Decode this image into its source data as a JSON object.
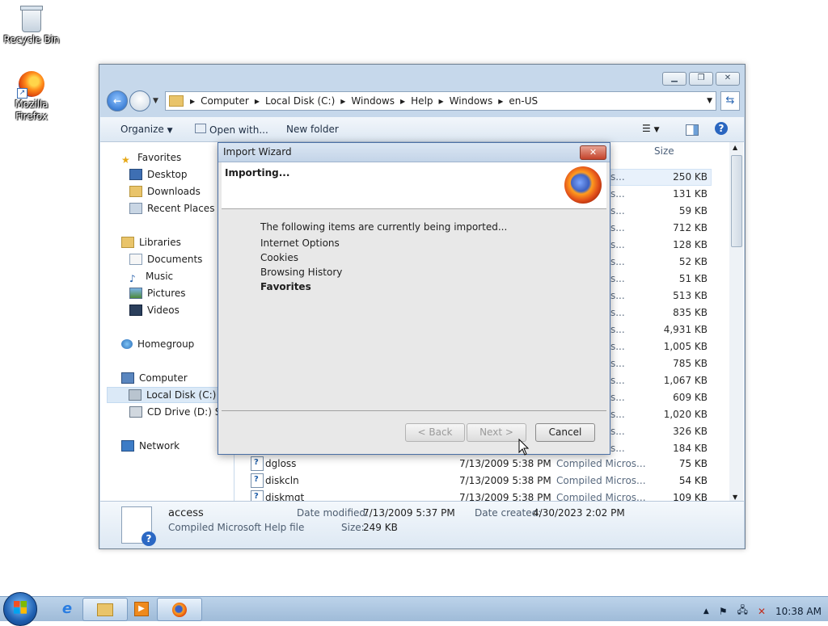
{
  "desktop": {
    "icons": [
      {
        "label": "Recycle Bin"
      },
      {
        "label_line1": "Mozilla",
        "label_line2": "Firefox"
      }
    ]
  },
  "explorer": {
    "caption_buttons": [
      "minimize",
      "restore",
      "close"
    ],
    "address": {
      "crumbs": [
        "Computer",
        "Local Disk (C:)",
        "Windows",
        "Help",
        "Windows",
        "en-US"
      ]
    },
    "toolbar": {
      "organize": "Organize",
      "open_with": "Open with...",
      "new_folder": "New folder"
    },
    "sidebar": {
      "favorites": "Favorites",
      "desktop": "Desktop",
      "downloads": "Downloads",
      "recent_places": "Recent Places",
      "libraries": "Libraries",
      "documents": "Documents",
      "music": "Music",
      "pictures": "Pictures",
      "videos": "Videos",
      "homegroup": "Homegroup",
      "computer": "Computer",
      "local_disk": "Local Disk (C:)",
      "cd_drive": "CD Drive (D:) Sta",
      "network": "Network"
    },
    "columns": {
      "size": "Size"
    },
    "type_partial": "icros...",
    "sizes": [
      "250 KB",
      "131 KB",
      "59 KB",
      "712 KB",
      "128 KB",
      "52 KB",
      "51 KB",
      "513 KB",
      "835 KB",
      "4,931 KB",
      "1,005 KB",
      "785 KB",
      "1,067 KB",
      "609 KB",
      "1,020 KB",
      "326 KB",
      "184 KB"
    ],
    "files": [
      {
        "name": "dgloss",
        "date": "7/13/2009 5:38 PM",
        "type": "Compiled Micros...",
        "size": "75 KB"
      },
      {
        "name": "diskcln",
        "date": "7/13/2009 5:38 PM",
        "type": "Compiled Micros...",
        "size": "54 KB"
      },
      {
        "name": "diskmgt",
        "date": "7/13/2009 5:38 PM",
        "type": "Compiled Micros...",
        "size": "109 KB"
      }
    ],
    "details": {
      "name": "access",
      "type": "Compiled Microsoft Help file",
      "date_modified_label": "Date modified:",
      "date_modified": "7/13/2009 5:37 PM",
      "date_created_label": "Date created:",
      "date_created": "4/30/2023 2:02 PM",
      "size_label": "Size:",
      "size": "249 KB"
    }
  },
  "dialog": {
    "title": "Import Wizard",
    "heading": "Importing...",
    "intro": "The following items are currently being imported...",
    "items": [
      "Internet Options",
      "Cookies",
      "Browsing History",
      "Favorites"
    ],
    "current_item_index": 3,
    "buttons": {
      "back": "< Back",
      "next": "Next >",
      "cancel": "Cancel"
    }
  },
  "taskbar": {
    "clock": "10:38 AM"
  },
  "colors": {
    "window_frame": "#c6d8eb",
    "selection": "#dbe9f7",
    "taskbar": "#bcd3ea"
  }
}
